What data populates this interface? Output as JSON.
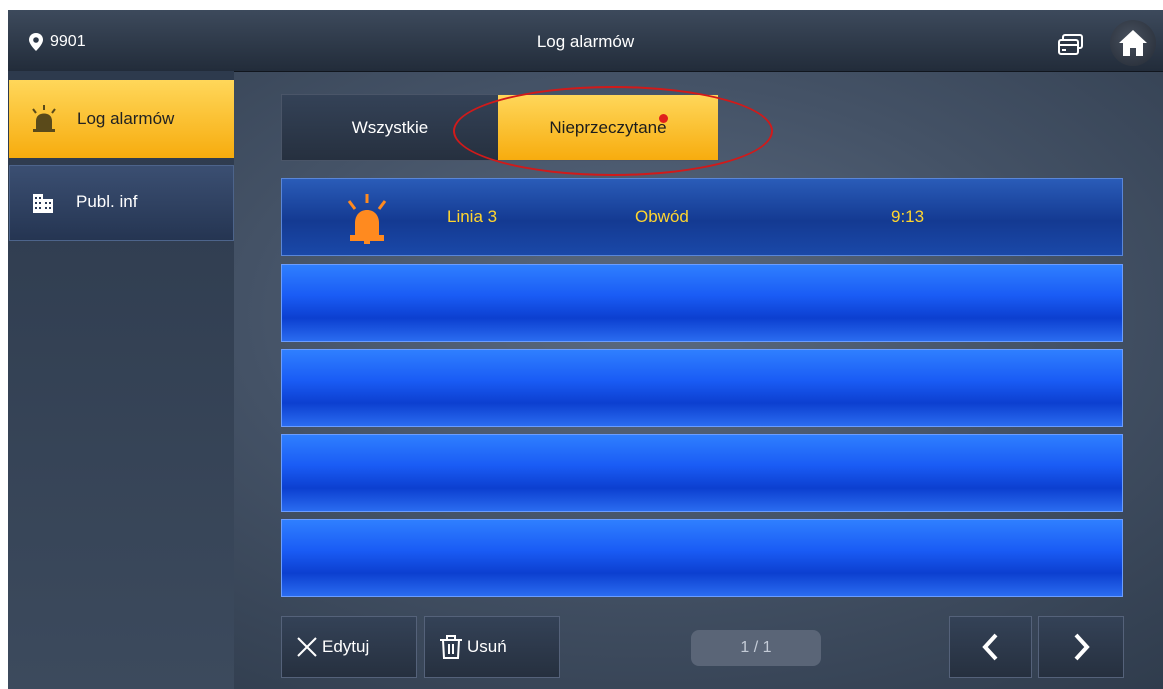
{
  "header": {
    "room_number": "9901",
    "title": "Log alarmów",
    "icons": [
      "location-pin-icon",
      "cards-icon",
      "home-icon"
    ]
  },
  "sidebar": {
    "items": [
      {
        "label": "Log alarmów",
        "icon": "alarm-bell-icon",
        "active": true
      },
      {
        "label": "Publ. inf",
        "icon": "building-icon",
        "active": false
      }
    ]
  },
  "tabs": [
    {
      "label": "Wszystkie",
      "active": false
    },
    {
      "label": "Nieprzeczytane",
      "active": true
    }
  ],
  "alarm_log": {
    "rows": [
      {
        "icon": "alarm-bell-icon",
        "line": "Linia 3",
        "type": "Obwód",
        "time": "9:13"
      },
      {
        "line": "",
        "type": "",
        "time": ""
      },
      {
        "line": "",
        "type": "",
        "time": ""
      },
      {
        "line": "",
        "type": "",
        "time": ""
      },
      {
        "line": "",
        "type": "",
        "time": ""
      }
    ]
  },
  "footer": {
    "edit_label": "Edytuj",
    "delete_label": "Usuń",
    "page_indicator": "1 / 1",
    "icons": [
      "close-x-icon",
      "trash-icon",
      "chevron-left-icon",
      "chevron-right-icon"
    ]
  },
  "colors": {
    "accent_yellow": "#f7ac0e",
    "row_blue": "#1a5cf5",
    "highlight_red": "#d11a1a",
    "alarm_text": "#ffd52e",
    "bell_orange": "#ff8a1f"
  }
}
